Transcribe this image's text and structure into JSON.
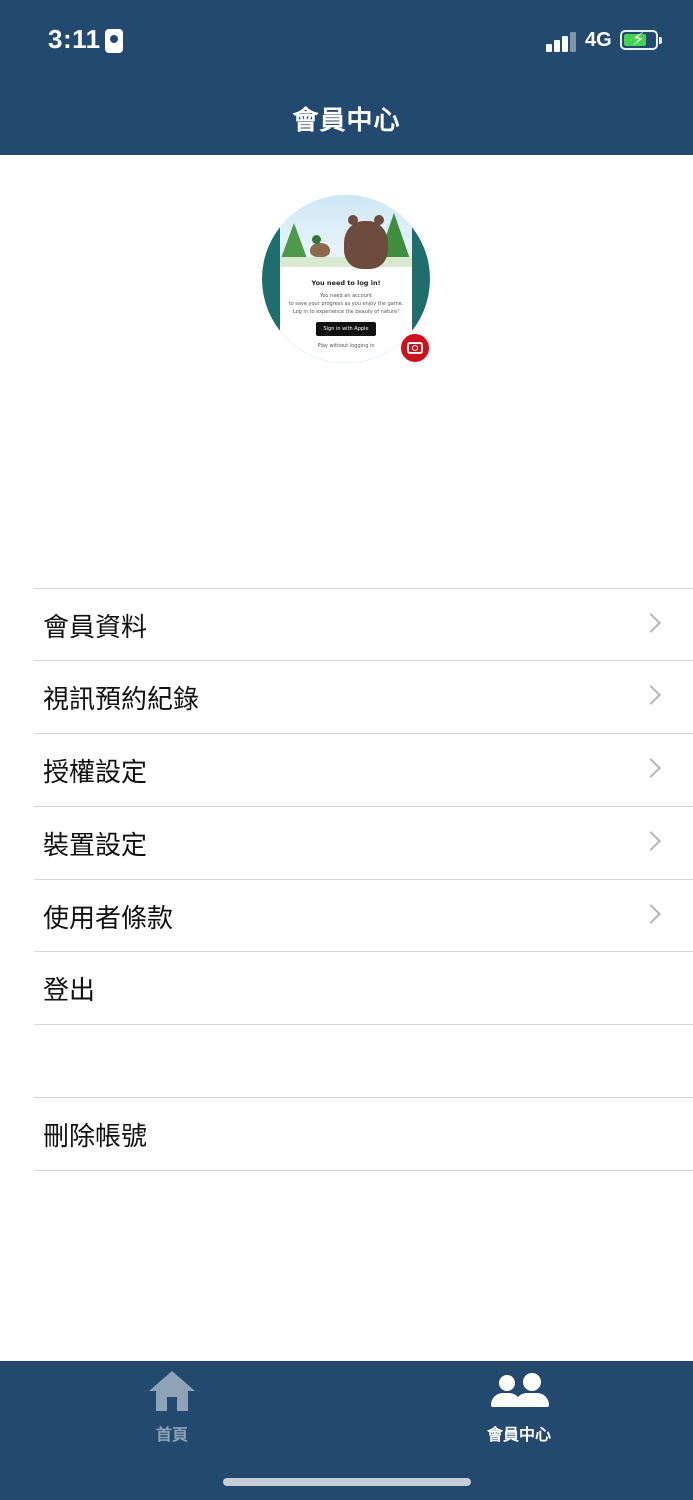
{
  "status_bar": {
    "time": "3:11",
    "network": "4G",
    "battery_charging": true,
    "battery_color": "#43d34f"
  },
  "header": {
    "title": "會員中心",
    "background": "#234a6e"
  },
  "avatar": {
    "card_title": "You need to log in!",
    "card_body": "You need an account\nto save your progress as you enjoy the game.\nLog in to experience the beauty of nature!",
    "card_button": " Sign in with Apple",
    "card_skip": "Play without logging in",
    "camera_icon": "camera-icon",
    "camera_color": "#d0101b"
  },
  "menu": {
    "items": [
      {
        "label": "會員資料",
        "chevron": true
      },
      {
        "label": "視訊預約紀錄",
        "chevron": true
      },
      {
        "label": "授權設定",
        "chevron": true
      },
      {
        "label": "裝置設定",
        "chevron": true
      },
      {
        "label": "使用者條款",
        "chevron": true
      },
      {
        "label": "登出",
        "chevron": false
      }
    ],
    "delete_account": {
      "label": "刪除帳號"
    }
  },
  "tabbar": {
    "tabs": [
      {
        "label": "首頁",
        "icon": "home-icon",
        "active": false,
        "color": "#8fa3b6"
      },
      {
        "label": "會員中心",
        "icon": "members-icon",
        "active": true,
        "color": "#ffffff"
      }
    ]
  }
}
